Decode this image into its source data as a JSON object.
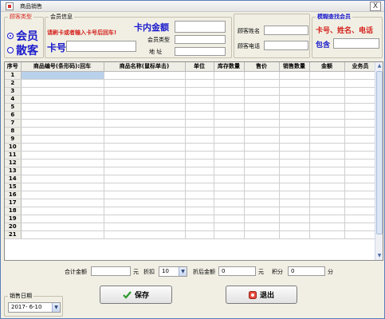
{
  "window": {
    "title": "商品销售",
    "close": "X"
  },
  "customer_type": {
    "legend": "顾客类型",
    "member": "会员",
    "walkin": "散客",
    "selected": "member"
  },
  "member_info": {
    "legend": "会员信息",
    "prompt": "请刷卡或者输入卡号后回车!",
    "card_no_label": "卡号",
    "card_balance_label": "卡内金额",
    "member_type_label": "会员类型",
    "address_label": "地    址",
    "customer_name_label": "顾客姓名",
    "customer_phone_label": "顾客电话"
  },
  "fuzzy": {
    "legend": "模糊查找会员",
    "hint": "卡号、姓名、电话",
    "contains_label": "包含"
  },
  "grid": {
    "columns": [
      "序号",
      "商品编号(条形码):回车",
      "商品名称(鼠标单击)",
      "单位",
      "库存数量",
      "售价",
      "销售数量",
      "金额",
      "业务员"
    ],
    "rows": [
      "1",
      "2",
      "3",
      "4",
      "5",
      "6",
      "7",
      "8",
      "9",
      "10",
      "11",
      "12",
      "13",
      "14",
      "15",
      "16",
      "17",
      "18",
      "19",
      "20",
      "21"
    ]
  },
  "totals": {
    "total_label": "合计金额",
    "yuan": "元",
    "discount_label": "折扣",
    "discount_value": "10",
    "after_discount_label": "折后金额",
    "after_discount_value": "0",
    "points_label": "积分",
    "points_value": "0",
    "points_unit": "分"
  },
  "sale_date": {
    "legend": "销售日期",
    "value": "2017- 6-10"
  },
  "buttons": {
    "save": "保存",
    "exit": "退出"
  },
  "colors": {
    "accent_red": "#d4201b",
    "accent_blue": "#1a1acc",
    "selected_cell": "#b9d1ea"
  }
}
